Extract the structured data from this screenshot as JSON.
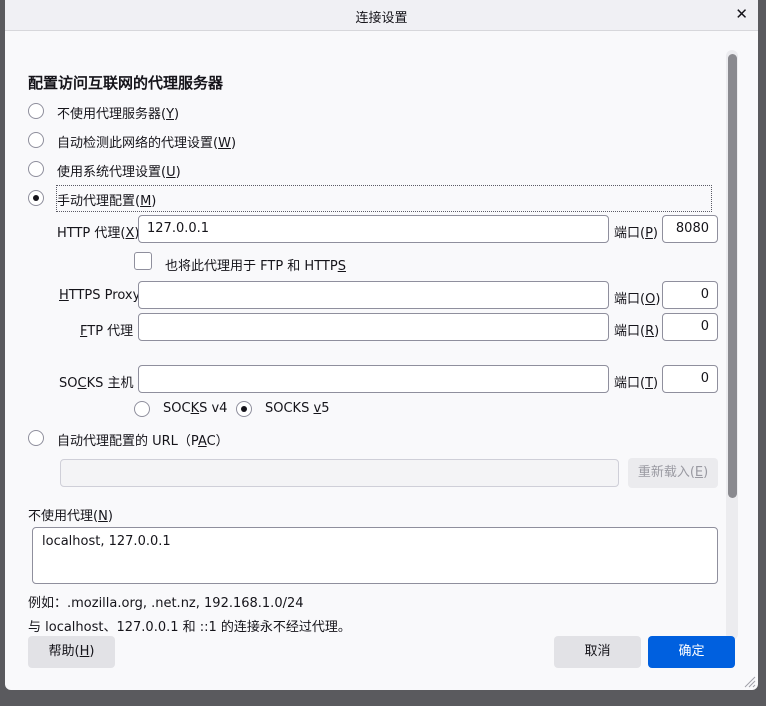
{
  "window": {
    "title": "连接设置",
    "close_glyph": "✕"
  },
  "section_title": "配置访问互联网的代理服务器",
  "proxy_modes": [
    {
      "label": "不使用代理服务器(",
      "key": "Y",
      "suffix": ")",
      "checked": false
    },
    {
      "label": "自动检测此网络的代理设置(",
      "key": "W",
      "suffix": ")",
      "checked": false
    },
    {
      "label": "使用系统代理设置(",
      "key": "U",
      "suffix": ")",
      "checked": false
    },
    {
      "label": "手动代理配置(",
      "key": "M",
      "suffix": ")",
      "checked": true
    }
  ],
  "http": {
    "label_pre": "HTTP 代理(",
    "label_key": "X",
    "label_post": ")",
    "value": "127.0.0.1",
    "port_label_pre": "端口(",
    "port_key": "P",
    "port_post": ")",
    "port_value": "8080"
  },
  "also_use": {
    "label_pre": "也将此代理用于 FTP 和 HTTP",
    "label_key": "S",
    "checked": false
  },
  "https": {
    "label_key": "H",
    "label_post": "TTPS Proxy",
    "value": "",
    "port_label_pre": "端口(",
    "port_key": "O",
    "port_post": ")",
    "port_value": "0"
  },
  "ftp": {
    "label_key": "F",
    "label_post": "TP 代理",
    "value": "",
    "port_label_pre": "端口(",
    "port_key": "R",
    "port_post": ")",
    "port_value": "0"
  },
  "socks": {
    "label_pre": "SO",
    "label_key": "C",
    "label_post": "KS 主机",
    "value": "",
    "port_label_pre": "端口(",
    "port_key": "T",
    "port_post": ")",
    "port_value": "0",
    "v4_pre": "SOC",
    "v4_key": "K",
    "v4_post": "S v4",
    "v4_checked": false,
    "v5_pre": "SOCKS ",
    "v5_key": "v",
    "v5_post": "5",
    "v5_checked": true
  },
  "pac": {
    "label_pre": "自动代理配置的 URL（P",
    "label_key": "A",
    "label_post": "C）",
    "value": "",
    "reload_pre": "重新载入(",
    "reload_key": "E",
    "reload_post": ")"
  },
  "no_proxy": {
    "label_pre": "不使用代理(",
    "label_key": "N",
    "label_post": ")",
    "value": "localhost, 127.0.0.1",
    "example": "例如：.mozilla.org, .net.nz, 192.168.1.0/24",
    "note": "与 localhost、127.0.0.1 和 ::1 的连接永不经过代理。"
  },
  "buttons": {
    "help_pre": "帮助(",
    "help_key": "H",
    "help_post": ")",
    "cancel": "取消",
    "ok": "确定"
  },
  "colors": {
    "accent": "#0060df",
    "dialog_bg": "#f9f9fb",
    "backdrop": "#5a5a5e"
  }
}
